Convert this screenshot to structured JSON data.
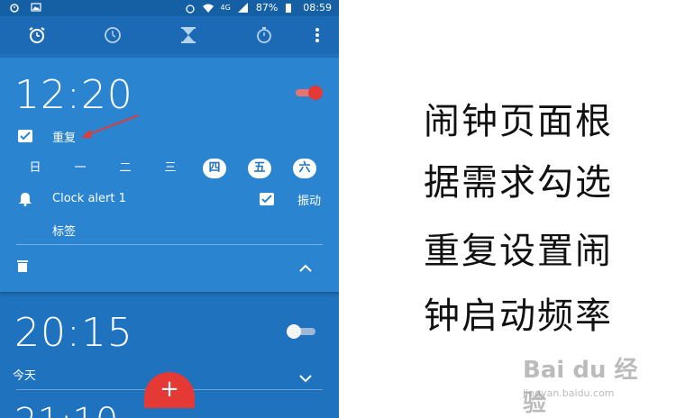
{
  "status_bar": {
    "network": "4G",
    "battery": "87%",
    "time": "08:59"
  },
  "tabs": {
    "icons": [
      "alarm-icon",
      "clock-icon",
      "timer-icon",
      "stopwatch-icon",
      "more-vert-icon"
    ]
  },
  "alarm1": {
    "time": "12:20",
    "enabled": true,
    "repeat_label": "重复",
    "repeat_checked": true,
    "days": [
      {
        "label": "日",
        "selected": false
      },
      {
        "label": "一",
        "selected": false
      },
      {
        "label": "二",
        "selected": false
      },
      {
        "label": "三",
        "selected": false
      },
      {
        "label": "四",
        "selected": true
      },
      {
        "label": "五",
        "selected": true
      },
      {
        "label": "六",
        "selected": true
      }
    ],
    "ringtone": "Clock alert 1",
    "vibrate_label": "振动",
    "vibrate_checked": true,
    "tag_label": "标签"
  },
  "alarm2": {
    "time": "20:15",
    "enabled": false,
    "day_label": "今天"
  },
  "alarm3": {
    "time_partial": "21:10"
  },
  "fab": {
    "label": "+"
  },
  "caption": {
    "lines": [
      "闹钟页面根",
      "据需求勾选",
      "重复设置闹",
      "钟启动频率"
    ]
  },
  "watermark": {
    "brand": "Bai du 经验",
    "url": "jingyan.baidu.com"
  },
  "colors": {
    "background": "#1f72be",
    "card": "#2b84d0",
    "accent": "#e53935"
  }
}
